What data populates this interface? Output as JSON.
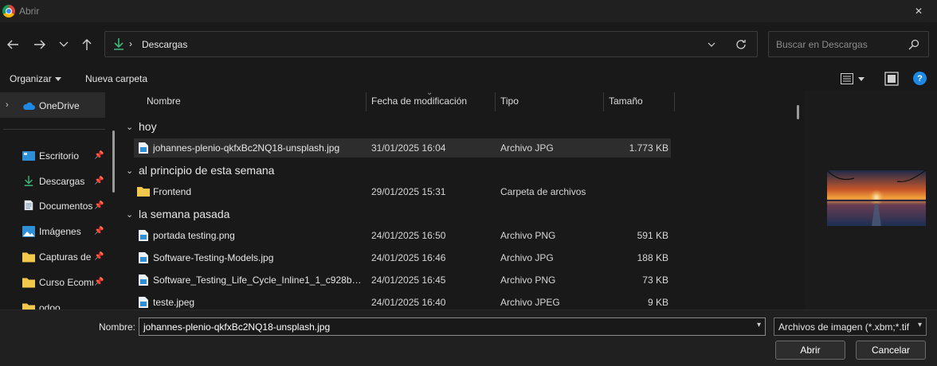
{
  "window": {
    "title": "Abrir",
    "close_glyph": "✕"
  },
  "nav": {
    "back_glyph": "←",
    "forward_glyph": "→",
    "recent_glyph": "⌄",
    "up_glyph": "↑",
    "path_separator": "›",
    "path": "Descargas",
    "search_placeholder": "Buscar en Descargas"
  },
  "toolbar": {
    "organize_label": "Organizar",
    "new_folder_label": "Nueva carpeta",
    "help_glyph": "?"
  },
  "sidebar": {
    "items": [
      {
        "label": "OneDrive",
        "icon": "cloud-icon",
        "pinned": false
      },
      {
        "label": "Escritorio",
        "icon": "desktop-icon",
        "pinned": true
      },
      {
        "label": "Descargas",
        "icon": "download-icon",
        "pinned": true
      },
      {
        "label": "Documentos",
        "icon": "document-icon",
        "pinned": true
      },
      {
        "label": "Imágenes",
        "icon": "image-icon",
        "pinned": true
      },
      {
        "label": "Capturas de pantalla",
        "icon": "folder-icon",
        "pinned": true
      },
      {
        "label": "Curso Ecommerce",
        "icon": "folder-icon",
        "pinned": true
      },
      {
        "label": "odoo",
        "icon": "folder-icon",
        "pinned": false
      }
    ]
  },
  "columns": {
    "name": "Nombre",
    "date": "Fecha de modificación",
    "type": "Tipo",
    "size": "Tamaño"
  },
  "groups": [
    {
      "title": "hoy",
      "rows": [
        {
          "name": "johannes-plenio-qkfxBc2NQ18-unsplash.jpg",
          "date": "31/01/2025 16:04",
          "type": "Archivo JPG",
          "size": "1.773 KB",
          "icon": "image-file-icon",
          "selected": true
        }
      ]
    },
    {
      "title": "al principio de esta semana",
      "rows": [
        {
          "name": "Frontend",
          "date": "29/01/2025 15:31",
          "type": "Carpeta de archivos",
          "size": "",
          "icon": "folder-icon",
          "selected": false
        }
      ]
    },
    {
      "title": "la semana pasada",
      "rows": [
        {
          "name": "portada testing.png",
          "date": "24/01/2025 16:50",
          "type": "Archivo PNG",
          "size": "591 KB",
          "icon": "image-file-icon",
          "selected": false
        },
        {
          "name": "Software-Testing-Models.jpg",
          "date": "24/01/2025 16:46",
          "type": "Archivo JPG",
          "size": "188 KB",
          "icon": "image-file-icon",
          "selected": false
        },
        {
          "name": "Software_Testing_Life_Cycle_Inline1_1_c928b66...",
          "date": "24/01/2025 16:45",
          "type": "Archivo PNG",
          "size": "73 KB",
          "icon": "image-file-icon",
          "selected": false
        },
        {
          "name": "teste.jpeg",
          "date": "24/01/2025 16:40",
          "type": "Archivo JPEG",
          "size": "9 KB",
          "icon": "image-file-icon",
          "selected": false
        }
      ]
    }
  ],
  "footer": {
    "filename_label": "Nombre:",
    "filename_value": "johannes-plenio-qkfxBc2NQ18-unsplash.jpg",
    "filter_value": "Archivos de imagen (*.xbm;*.tif",
    "open_label": "Abrir",
    "cancel_label": "Cancelar"
  },
  "colors": {
    "accent": "#1e88e5",
    "folder": "#f2c94c",
    "download": "#3cb878"
  }
}
